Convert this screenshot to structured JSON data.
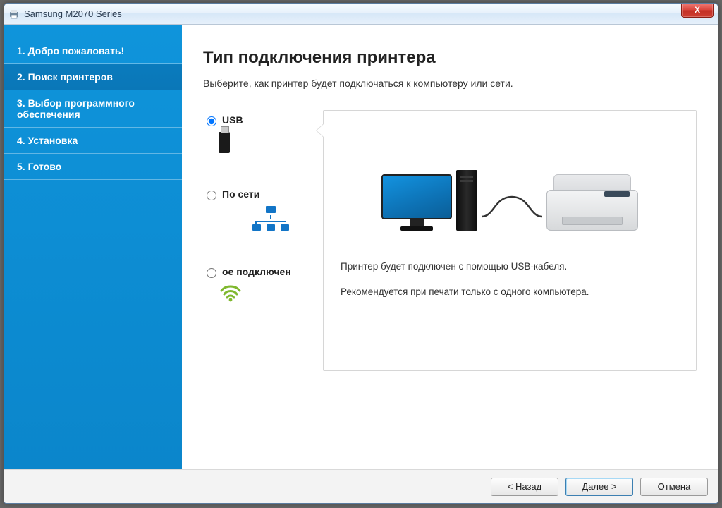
{
  "window": {
    "title": "Samsung M2070 Series",
    "close_label": "X"
  },
  "sidebar": {
    "steps": [
      {
        "label": "1. Добро пожаловать!"
      },
      {
        "label": "2. Поиск принтеров"
      },
      {
        "label": "3. Выбор программного обеспечения"
      },
      {
        "label": "4. Установка"
      },
      {
        "label": "5. Готово"
      }
    ],
    "active_index": 1
  },
  "main": {
    "heading": "Тип подключения принтера",
    "subtitle": "Выберите, как принтер будет подключаться к компьютеру или сети."
  },
  "options": {
    "usb": {
      "label": "USB",
      "selected": true
    },
    "network": {
      "label": "По сети",
      "selected": false
    },
    "wireless": {
      "label": "ое подключен",
      "selected": false
    }
  },
  "preview": {
    "line1": "Принтер будет подключен с помощью USB-кабеля.",
    "line2": "Рекомендуется при печати только с одного компьютера."
  },
  "footer": {
    "back": "< Назад",
    "next": "Далее >",
    "cancel": "Отмена"
  }
}
